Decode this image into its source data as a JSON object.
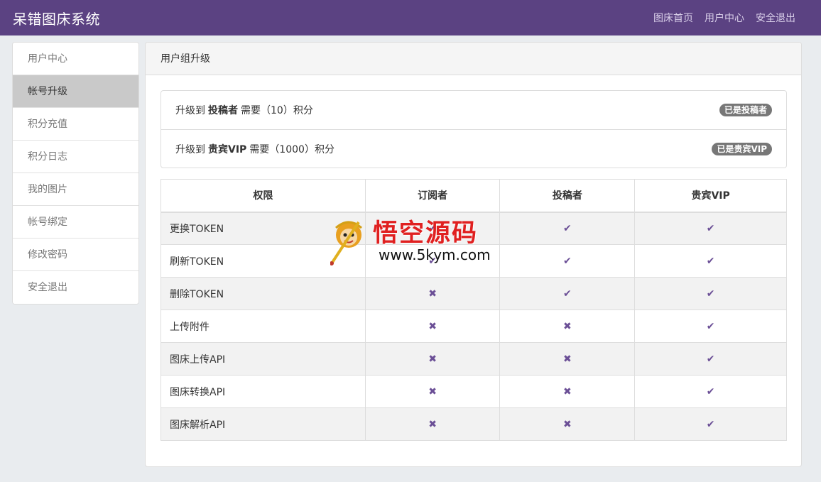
{
  "navbar": {
    "brand": "呆错图床系统",
    "links": [
      "图床首页",
      "用户中心",
      "安全退出"
    ]
  },
  "sidebar": {
    "items": [
      {
        "label": "用户中心",
        "active": false
      },
      {
        "label": "帐号升级",
        "active": true
      },
      {
        "label": "积分充值",
        "active": false
      },
      {
        "label": "积分日志",
        "active": false
      },
      {
        "label": "我的图片",
        "active": false
      },
      {
        "label": "帐号绑定",
        "active": false
      },
      {
        "label": "修改密码",
        "active": false
      },
      {
        "label": "安全退出",
        "active": false
      }
    ]
  },
  "panel": {
    "title": "用户组升级",
    "upgrades": [
      {
        "prefix": "升级到",
        "group": "投稿者",
        "need": "需要（10）积分",
        "badge": "已是投稿者"
      },
      {
        "prefix": "升级到",
        "group": "贵宾VIP",
        "need": "需要（1000）积分",
        "badge": "已是贵宾VIP"
      }
    ],
    "table": {
      "headers": [
        "权限",
        "订阅者",
        "投稿者",
        "贵宾VIP"
      ],
      "rows": [
        {
          "name": "更换TOKEN",
          "marks": [
            "check",
            "check",
            "check"
          ]
        },
        {
          "name": "刷新TOKEN",
          "marks": [
            "check",
            "check",
            "check"
          ]
        },
        {
          "name": "删除TOKEN",
          "marks": [
            "cross",
            "check",
            "check"
          ]
        },
        {
          "name": "上传附件",
          "marks": [
            "cross",
            "cross",
            "check"
          ]
        },
        {
          "name": "图床上传API",
          "marks": [
            "cross",
            "cross",
            "check"
          ]
        },
        {
          "name": "图床转换API",
          "marks": [
            "cross",
            "cross",
            "check"
          ]
        },
        {
          "name": "图床解析API",
          "marks": [
            "cross",
            "cross",
            "check"
          ]
        }
      ]
    }
  },
  "watermark": {
    "title": "悟空源码",
    "url": "www.5kym.com"
  },
  "colors": {
    "navbar": "#5b4282",
    "accent": "#6b4f96",
    "badge": "#777777"
  },
  "icons": {
    "check": "✔",
    "cross": "✖"
  }
}
